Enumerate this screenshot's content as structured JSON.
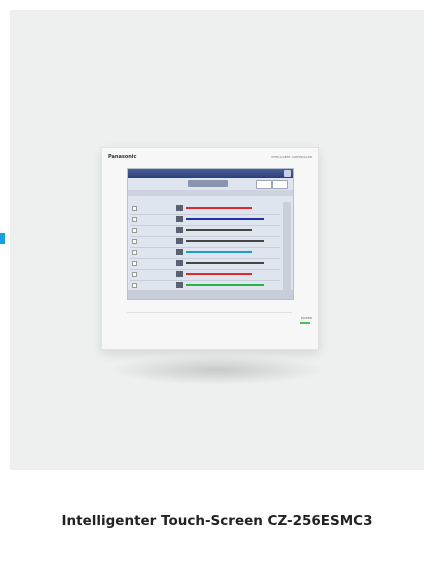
{
  "caption": "Intelligenter Touch-Screen CZ-256ESMC3",
  "device": {
    "brand": "Panasonic",
    "model_tag": "INTELLIGENT CONTROLLER",
    "power_label": "POWER"
  },
  "screen_rows": [
    {
      "color": "#e0282e"
    },
    {
      "color": "#2433a8"
    },
    {
      "color": "#444444"
    },
    {
      "color": "#444444"
    },
    {
      "color": "#1f9ad6"
    },
    {
      "color": "#444444"
    },
    {
      "color": "#e0282e"
    },
    {
      "color": "#2bb04a"
    }
  ],
  "colors": {
    "background": "#edf0ef",
    "accent_tab": "#1aa0d8",
    "caption": "#222222"
  }
}
